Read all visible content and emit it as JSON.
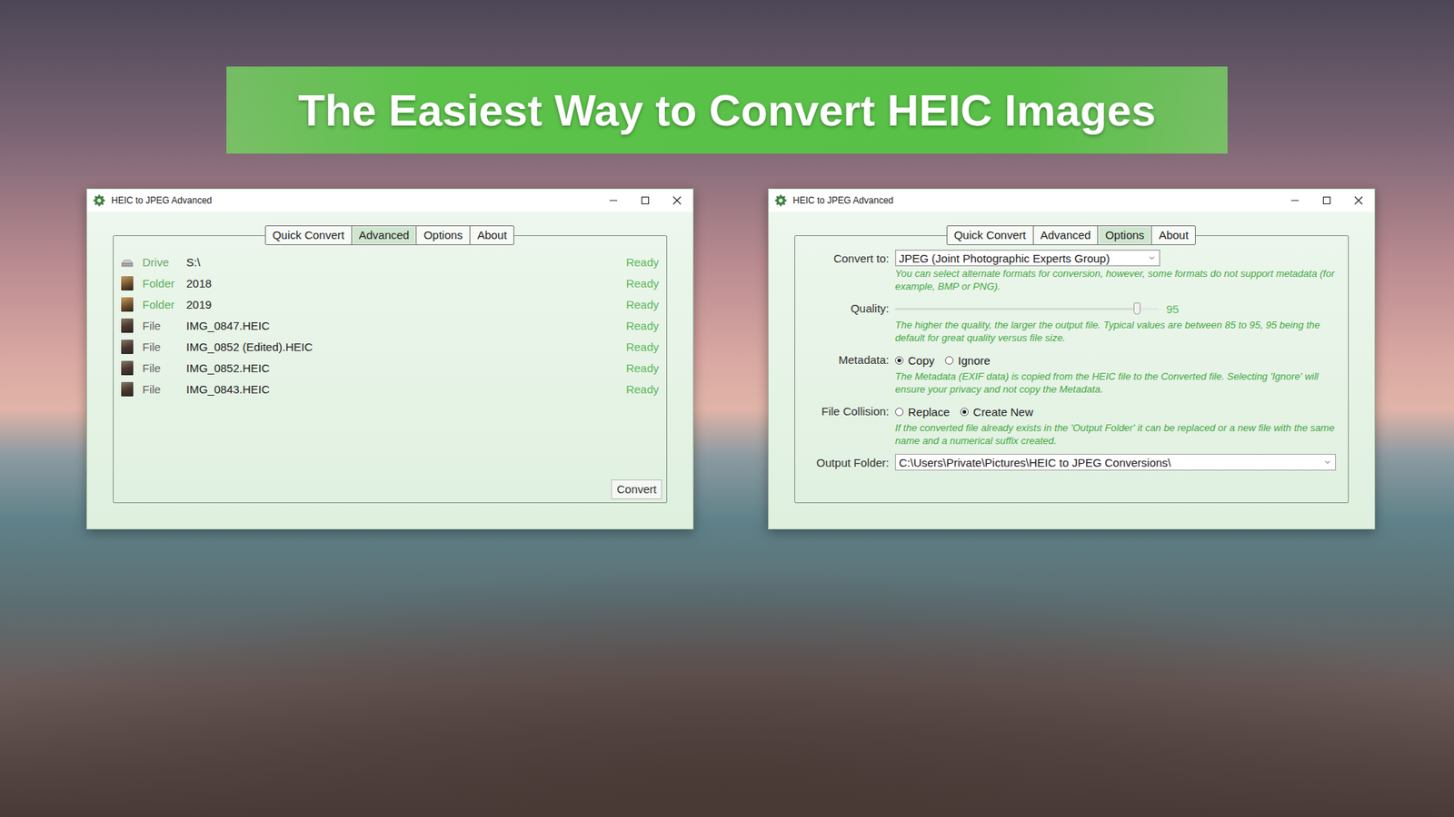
{
  "banner": {
    "title": "The Easiest Way to Convert HEIC Images"
  },
  "queue_window": {
    "title": "HEIC to JPEG Advanced",
    "tabs": [
      {
        "label": "Quick Convert",
        "selected": false
      },
      {
        "label": "Advanced",
        "selected": true
      },
      {
        "label": "Options",
        "selected": false
      },
      {
        "label": "About",
        "selected": false
      }
    ],
    "items": [
      {
        "kind": "drive",
        "type": "Drive",
        "name": "S:\\",
        "status": "Ready"
      },
      {
        "kind": "folder",
        "type": "Folder",
        "name": "2018",
        "status": "Ready"
      },
      {
        "kind": "folder",
        "type": "Folder",
        "name": "2019",
        "status": "Ready"
      },
      {
        "kind": "file",
        "type": "File",
        "name": "IMG_0847.HEIC",
        "status": "Ready"
      },
      {
        "kind": "file",
        "type": "File",
        "name": "IMG_0852 (Edited).HEIC",
        "status": "Ready"
      },
      {
        "kind": "file",
        "type": "File",
        "name": "IMG_0852.HEIC",
        "status": "Ready"
      },
      {
        "kind": "file",
        "type": "File",
        "name": "IMG_0843.HEIC",
        "status": "Ready"
      }
    ],
    "convert_button": "Convert"
  },
  "options_window": {
    "title": "HEIC to JPEG Advanced",
    "tabs": [
      {
        "label": "Quick Convert",
        "selected": false
      },
      {
        "label": "Advanced",
        "selected": false
      },
      {
        "label": "Options",
        "selected": true
      },
      {
        "label": "About",
        "selected": false
      }
    ],
    "fields": [
      {
        "kind": "select",
        "label": "Convert to:",
        "value": "JPEG (Joint Photographic Experts Group)",
        "note": "You can select alternate formats for conversion, however, some formats do not support metadata (for example, BMP or PNG)."
      },
      {
        "kind": "slider",
        "label": "Quality:",
        "level": 0.92,
        "reading": "95",
        "note": "The higher the quality, the larger the output file. Typical values are between 85 to 95, 95 being the default for great quality versus file size."
      },
      {
        "kind": "radio",
        "label": "Metadata:",
        "choices": [
          {
            "label": "Copy",
            "selected": true
          },
          {
            "label": "Ignore",
            "selected": false
          }
        ],
        "note": "The Metadata (EXIF data) is copied from the HEIC file to the Converted file. Selecting 'Ignore' will ensure your privacy and not copy the Metadata."
      },
      {
        "kind": "radio",
        "label": "File Collision:",
        "choices": [
          {
            "label": "Replace",
            "selected": false
          },
          {
            "label": "Create New",
            "selected": true
          }
        ],
        "note": "If the converted file already exists in the 'Output Folder' it can be replaced or a new file with the same name and a numerical suffix created."
      },
      {
        "kind": "path",
        "label": "Output Folder:",
        "value": "C:\\Users\\Private\\Pictures\\HEIC to JPEG Conversions\\"
      }
    ]
  }
}
